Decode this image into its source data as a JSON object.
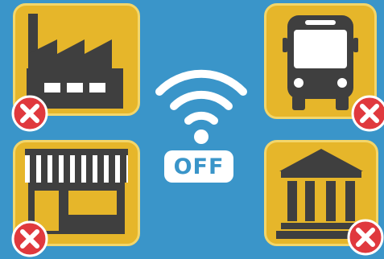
{
  "wifi_status": {
    "label": "OFF"
  },
  "tiles": [
    {
      "name": "factory",
      "icon": "factory-icon",
      "status_icon": "close-icon"
    },
    {
      "name": "bus",
      "icon": "bus-icon",
      "status_icon": "close-icon"
    },
    {
      "name": "shop",
      "icon": "shop-icon",
      "status_icon": "close-icon"
    },
    {
      "name": "bank",
      "icon": "bank-icon",
      "status_icon": "close-icon"
    }
  ],
  "colors": {
    "background": "#3a95c9",
    "tile": "#e6b62a",
    "icon": "#3f3f3f",
    "badge": "#e0393e",
    "wifi": "#ffffff"
  }
}
